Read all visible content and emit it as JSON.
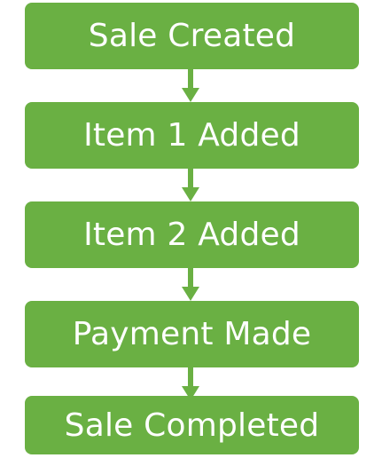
{
  "flow": {
    "steps": [
      {
        "label": "Sale Created"
      },
      {
        "label": "Item 1 Added"
      },
      {
        "label": "Item 2 Added"
      },
      {
        "label": "Payment Made"
      },
      {
        "label": "Sale Completed"
      }
    ],
    "colors": {
      "box_fill": "#6ab043",
      "text": "#ffffff",
      "arrow": "#6ab043"
    }
  }
}
